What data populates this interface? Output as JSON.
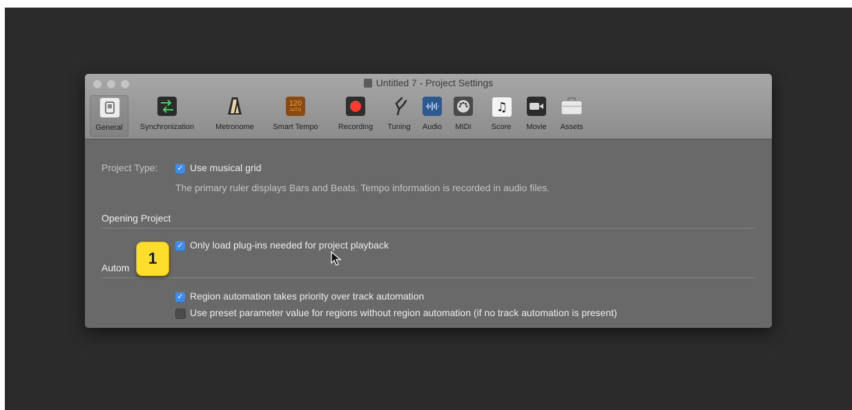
{
  "window": {
    "title": "Untitled 7 - Project Settings"
  },
  "toolbar": {
    "items": [
      {
        "label": "General",
        "icon": "general-switch-icon"
      },
      {
        "label": "Synchronization",
        "icon": "sync-arrows-icon"
      },
      {
        "label": "Metronome",
        "icon": "metronome-icon"
      },
      {
        "label": "Smart Tempo",
        "icon": "smart-tempo-icon",
        "icon_text": "120",
        "icon_subtext": "AUTO"
      },
      {
        "label": "Recording",
        "icon": "record-icon"
      },
      {
        "label": "Tuning",
        "icon": "tuning-fork-icon"
      },
      {
        "label": "Audio",
        "icon": "audio-waveform-icon"
      },
      {
        "label": "MIDI",
        "icon": "midi-port-icon"
      },
      {
        "label": "Score",
        "icon": "score-note-icon",
        "icon_text": "♫"
      },
      {
        "label": "Movie",
        "icon": "movie-camera-icon"
      },
      {
        "label": "Assets",
        "icon": "assets-briefcase-icon"
      }
    ],
    "selected": "General"
  },
  "general": {
    "project_type_label": "Project Type:",
    "use_musical_grid": {
      "label": "Use musical grid",
      "checked": true
    },
    "grid_description": "The primary ruler displays Bars and Beats. Tempo information is recorded in audio files.",
    "opening_project_heading": "Opening Project",
    "load_plugins": {
      "label": "Only load plug-ins needed for project playback",
      "checked": true
    },
    "automation_heading_partial": "Autom",
    "region_priority": {
      "label": "Region automation takes priority over track automation",
      "checked": true
    },
    "preset_parameter": {
      "label": "Use preset parameter value for regions without region automation (if no track automation is present)",
      "checked": false
    }
  },
  "callout": {
    "number": "1",
    "color": "#ffde2b"
  },
  "colors": {
    "checkbox_accent": "#3d8cf0",
    "record_red": "#ff3b30",
    "sync_green": "#3fd45c",
    "tempo_orange": "#d8821a"
  }
}
